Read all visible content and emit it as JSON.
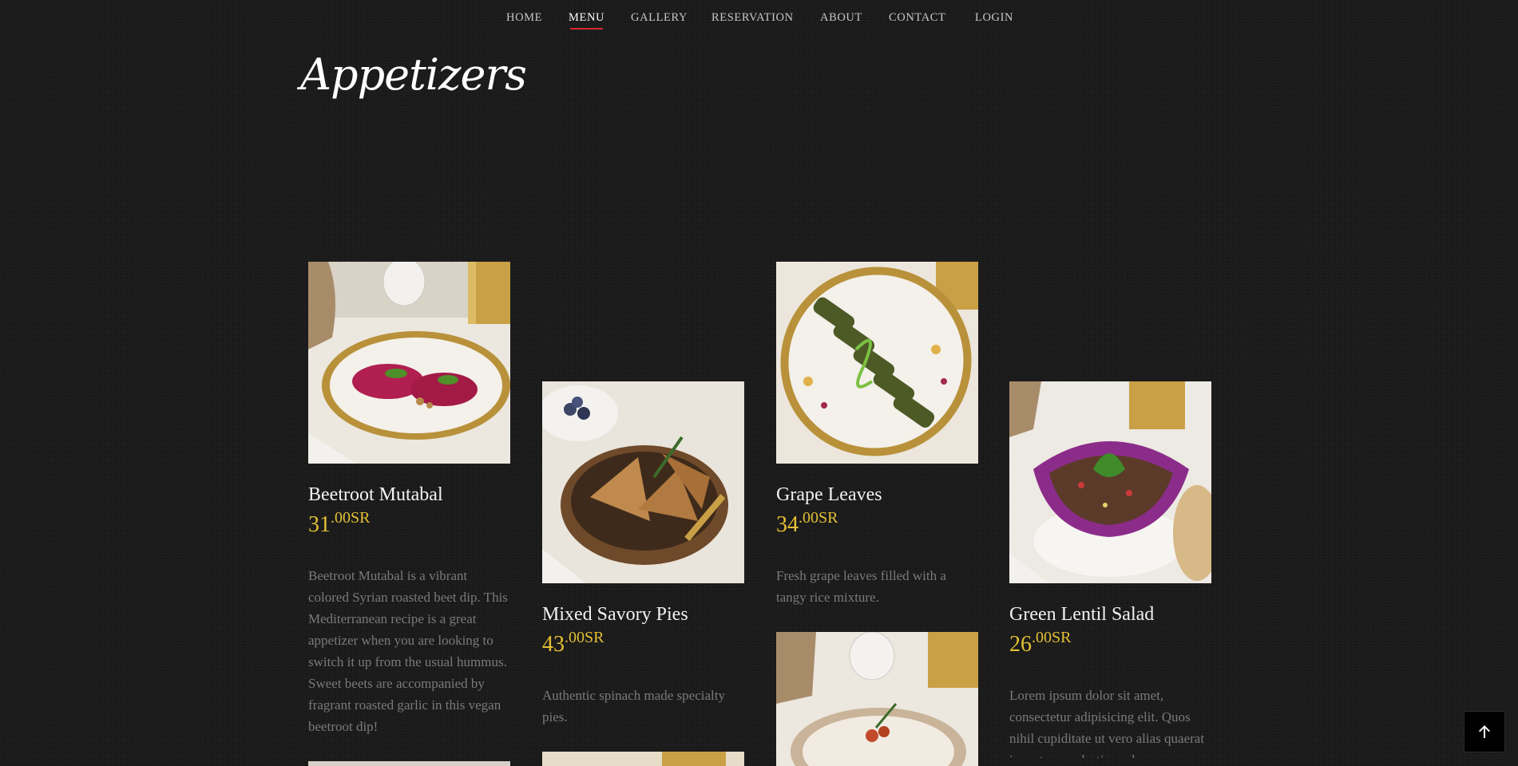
{
  "nav": {
    "items": [
      {
        "label": "HOME"
      },
      {
        "label": "MENU"
      },
      {
        "label": "GALLERY"
      },
      {
        "label": "RESERVATION"
      },
      {
        "label": "ABOUT"
      },
      {
        "label": "CONTACT"
      },
      {
        "label": "LOGIN"
      }
    ],
    "active": "MENU"
  },
  "section": {
    "title": "Appetizers"
  },
  "dishes": [
    {
      "name": "Beetroot Mutabal",
      "price_int": "31",
      "price_dec": ".00SR",
      "description": "Beetroot Mutabal is a vibrant colored Syrian roasted beet dip. This Mediterranean recipe is a great appetizer when you are looking to switch it up from the usual hummus. Sweet beets are accompanied by fragrant roasted garlic in this vegan beetroot dip!"
    },
    {
      "name": "Mixed Savory Pies",
      "price_int": "43",
      "price_dec": ".00SR",
      "description": "Authentic spinach made specialty pies."
    },
    {
      "name": "Grape Leaves",
      "price_int": "34",
      "price_dec": ".00SR",
      "description": "Fresh grape leaves filled with a tangy rice mixture."
    },
    {
      "name": "Green Lentil Salad",
      "price_int": "26",
      "price_dec": ".00SR",
      "description": "Lorem ipsum dolor sit amet, consectetur adipisicing elit. Quos nihil cupiditate ut vero alias quaerat inventore molestias vel"
    }
  ],
  "colors": {
    "background": "#1b1b1b",
    "price": "#e3c033",
    "nav_active_underline": "#d4282c",
    "description": "#7a7a7a"
  },
  "icons": {
    "back_to_top": "arrow-up-icon"
  }
}
